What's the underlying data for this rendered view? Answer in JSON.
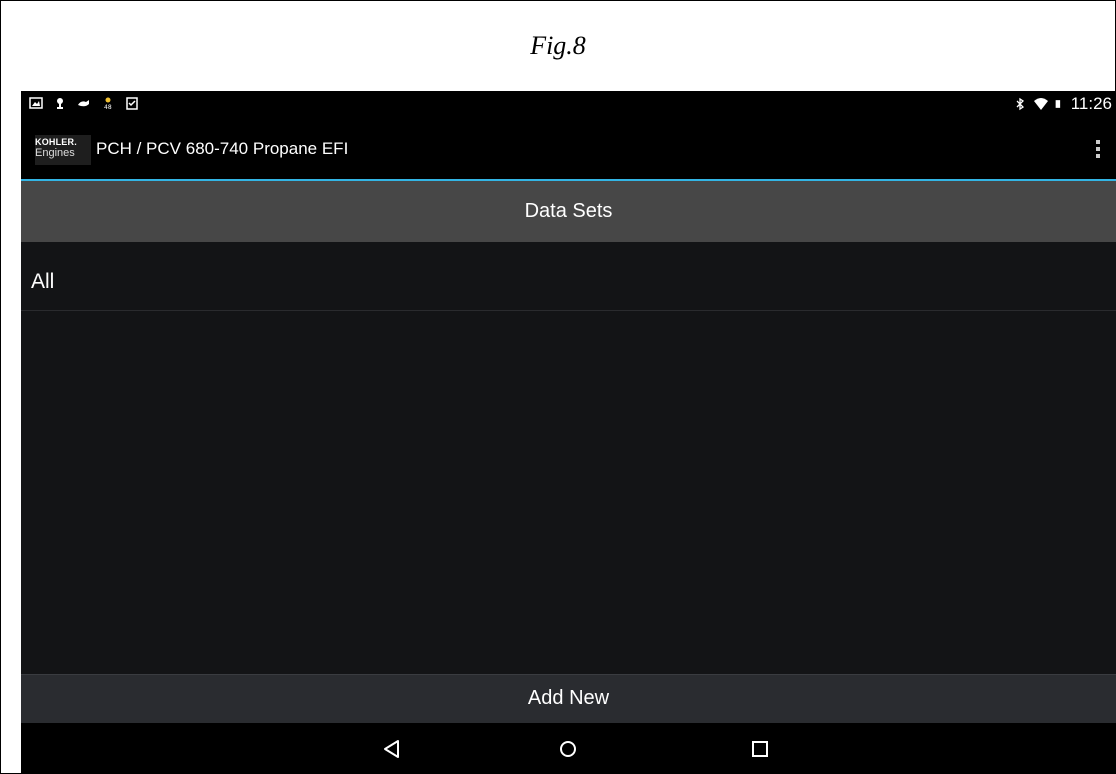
{
  "caption": "Fig.8",
  "status_bar": {
    "time": "11:26",
    "notification_icons": [
      "image-icon",
      "android-debug-icon",
      "whale-icon",
      "weather-icon",
      "clipboard-check-icon"
    ],
    "system_icons": [
      "bluetooth-icon",
      "wifi-icon",
      "battery-icon"
    ]
  },
  "action_bar": {
    "logo_line1": "KOHLER.",
    "logo_line2": "Engines",
    "title": "PCH / PCV 680-740 Propane EFI",
    "accent_color": "#33b5e5"
  },
  "section_header": "Data Sets",
  "list": {
    "items": [
      {
        "label": "All"
      }
    ]
  },
  "add_new_label": "Add New",
  "nav_bar": {
    "buttons": [
      "back-icon",
      "home-icon",
      "recents-icon"
    ]
  }
}
